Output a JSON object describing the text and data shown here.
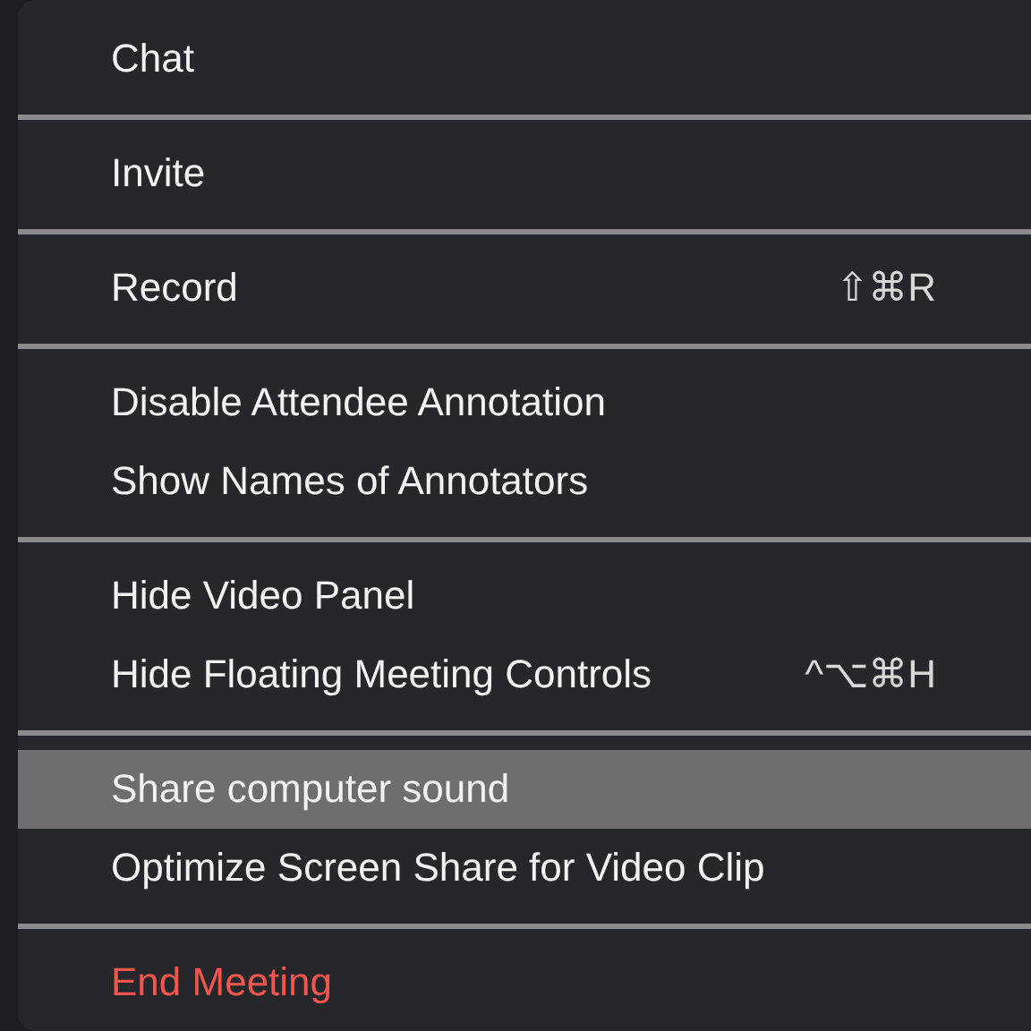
{
  "menu": {
    "groups": [
      {
        "items": [
          {
            "label": "Chat",
            "kind": "normal",
            "selected": false
          }
        ]
      },
      {
        "items": [
          {
            "label": "Invite",
            "kind": "normal",
            "selected": false
          }
        ]
      },
      {
        "items": [
          {
            "label": "Record",
            "kind": "normal",
            "selected": false,
            "shortcut": "⇧⌘R"
          }
        ]
      },
      {
        "items": [
          {
            "label": "Disable Attendee Annotation",
            "kind": "normal",
            "selected": false
          },
          {
            "label": "Show Names of Annotators",
            "kind": "normal",
            "selected": false
          }
        ]
      },
      {
        "items": [
          {
            "label": "Hide Video Panel",
            "kind": "normal",
            "selected": false
          },
          {
            "label": "Hide Floating Meeting Controls",
            "kind": "normal",
            "selected": false,
            "shortcut": "^⌥⌘H"
          }
        ]
      },
      {
        "items": [
          {
            "label": "Share computer sound",
            "kind": "normal",
            "selected": true
          },
          {
            "label": "Optimize Screen Share for Video Clip",
            "kind": "normal",
            "selected": false
          }
        ]
      },
      {
        "items": [
          {
            "label": "End Meeting",
            "kind": "destructive",
            "selected": false
          }
        ]
      }
    ]
  }
}
